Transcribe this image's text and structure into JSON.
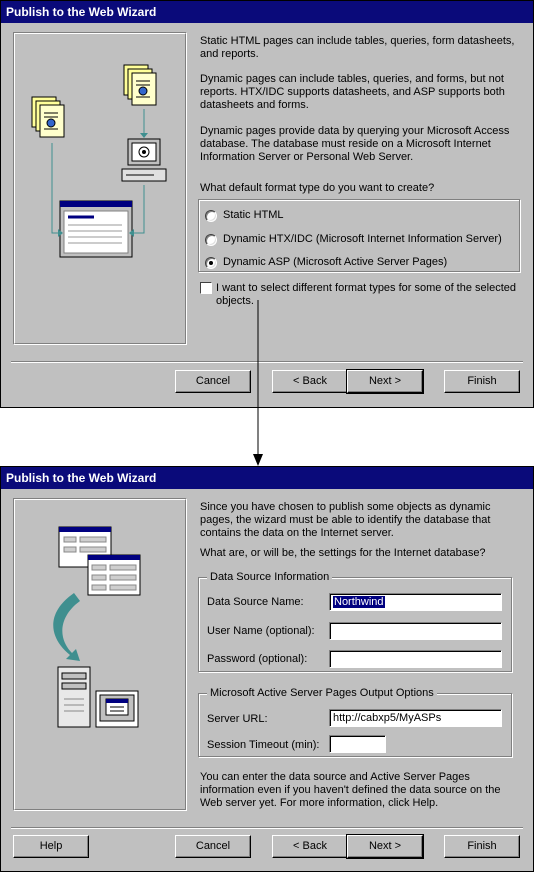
{
  "dialog1": {
    "title": "Publish to the Web Wizard",
    "paragraphs": [
      "Static HTML pages can include tables, queries, form datasheets, and reports.",
      "Dynamic pages can include tables, queries, and forms, but not reports. HTX/IDC supports datasheets, and ASP supports both datasheets and forms.",
      "Dynamic pages provide data by querying your Microsoft Access database. The database must reside on a Microsoft Internet Information Server or Personal Web Server."
    ],
    "question": "What default format type do you want to create?",
    "options": [
      {
        "label": "Static HTML",
        "selected": false
      },
      {
        "label": "Dynamic HTX/IDC (Microsoft Internet Information Server)",
        "selected": false
      },
      {
        "label": "Dynamic ASP (Microsoft Active Server Pages)",
        "selected": true
      }
    ],
    "checkbox_label": "I want to select different format types for some of the selected objects.",
    "checkbox_checked": false,
    "buttons": {
      "cancel": "Cancel",
      "back": "< Back",
      "next": "Next >",
      "finish": "Finish"
    }
  },
  "dialog2": {
    "title": "Publish to the Web Wizard",
    "intro": "Since you have chosen to publish some objects as dynamic pages, the wizard must be able to identify the database that contains the data on the Internet server.",
    "question": "What are, or will be, the settings for the Internet database?",
    "group1": {
      "label": "Data Source Information",
      "fields": [
        {
          "label": "Data Source Name:",
          "value": "Northwind"
        },
        {
          "label": "User Name (optional):",
          "value": ""
        },
        {
          "label": "Password (optional):",
          "value": ""
        }
      ]
    },
    "group2": {
      "label": "Microsoft Active Server Pages Output Options",
      "fields": [
        {
          "label": "Server URL:",
          "value": "http://cabxp5/MyASPs"
        },
        {
          "label": "Session Timeout (min):",
          "value": ""
        }
      ]
    },
    "footer": "You can enter the data source and Active Server Pages information even if you haven't defined the data source on the Web server yet. For more information, click Help.",
    "buttons": {
      "help": "Help",
      "cancel": "Cancel",
      "back": "< Back",
      "next": "Next >",
      "finish": "Finish"
    }
  },
  "colors": {
    "titlebar": "#0a0a7a",
    "face": "#c0c0c0",
    "selection": "#000080",
    "arrow_teal": "#3f8f8f"
  }
}
